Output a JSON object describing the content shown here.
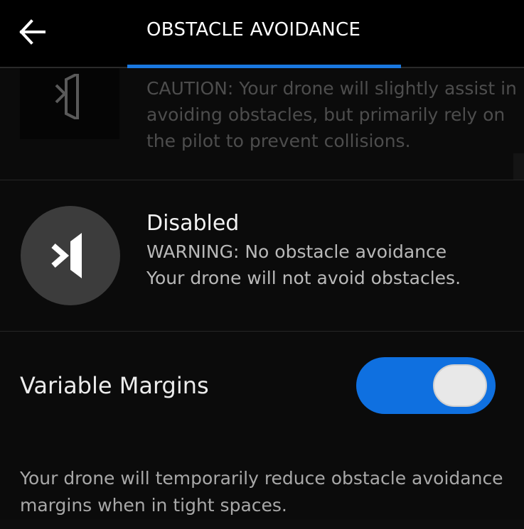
{
  "header": {
    "title": "OBSTACLE AVOIDANCE",
    "back_icon": "arrow-left-icon",
    "accent_color": "#1a78e0"
  },
  "modes": [
    {
      "icon": "obstacle-assist-icon",
      "description": "CAUTION: Your drone will slightly assist in avoiding obstacles, but primarily rely on the pilot to prevent collisions."
    },
    {
      "icon": "obstacle-disabled-icon",
      "title": "Disabled",
      "warning": "WARNING: No obstacle avoidance",
      "description": "Your drone will not avoid obstacles."
    }
  ],
  "variable_margins": {
    "label": "Variable Margins",
    "enabled": true,
    "toggle_color": "#0f70e0",
    "help": "Your drone will temporarily reduce obstacle avoidance margins when in tight spaces."
  }
}
